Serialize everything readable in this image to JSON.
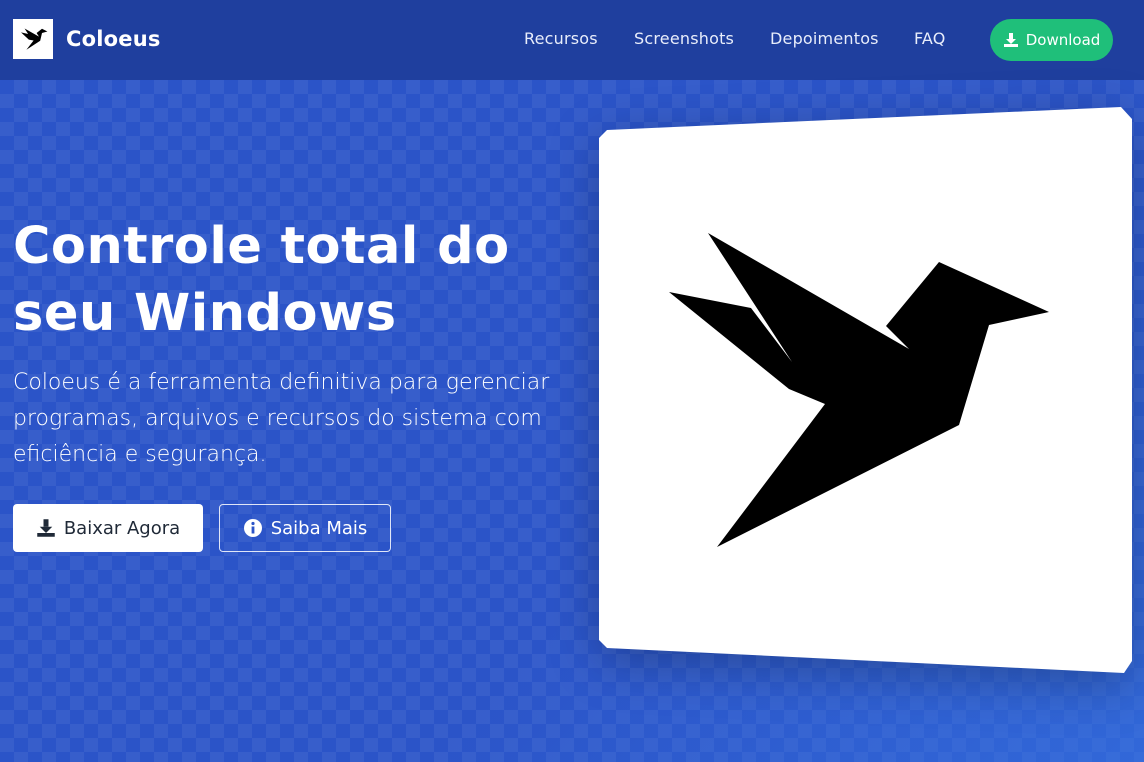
{
  "app": {
    "name": "Coloeus",
    "logo_icon": "hummingbird-icon"
  },
  "nav": {
    "links": [
      "Recursos",
      "Screenshots",
      "Depoimentos",
      "FAQ"
    ],
    "download_label": "Download",
    "download_icon": "download-icon"
  },
  "hero": {
    "title_line1": "Controle total do",
    "title_line2": "seu Windows",
    "description": "Coloeus é a ferramenta definitiva para gerenciar programas, arquivos e recursos do sistema com eficiência e segurança.",
    "primary_button": "Baixar Agora",
    "primary_icon": "download-icon",
    "secondary_button": "Saiba Mais",
    "secondary_icon": "info-icon",
    "image_icon": "hummingbird-icon"
  },
  "colors": {
    "navbar": "#1f3f9e",
    "hero_background": "#2b54c8",
    "accent_green": "#1fbf7a",
    "white": "#ffffff"
  }
}
